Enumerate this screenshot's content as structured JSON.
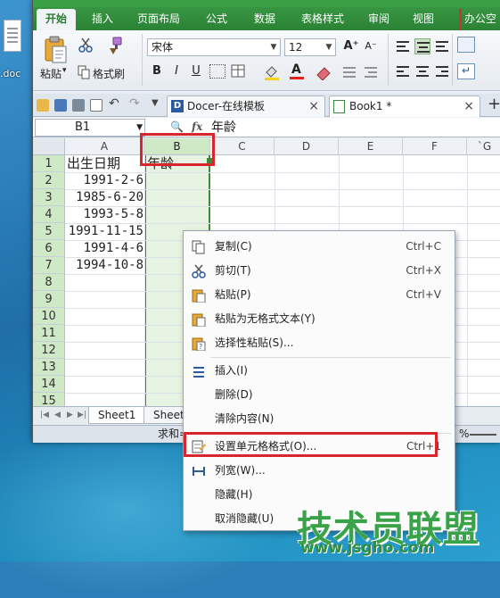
{
  "desktop": {
    "file_label": ".doc"
  },
  "ribbon_tabs": [
    "开始",
    "插入",
    "页面布局",
    "公式",
    "数据",
    "表格样式",
    "审阅",
    "视图",
    "办公空"
  ],
  "ribbon": {
    "paste": "粘贴",
    "format_painter": "格式刷",
    "font_name": "宋体",
    "font_size": "12",
    "bold": "B",
    "italic": "I",
    "underline": "U",
    "grow_font": "A⁺",
    "shrink_font": "A⁻"
  },
  "doc_tabs": [
    {
      "label": "Docer-在线模板",
      "close": "×"
    },
    {
      "label": "Book1 *",
      "close": "×"
    }
  ],
  "formula_bar": {
    "name_box": "B1",
    "fx": "fx",
    "value": "年龄"
  },
  "columns": [
    "A",
    "B",
    "C",
    "D",
    "E",
    "F",
    "`G"
  ],
  "rows": [
    "1",
    "2",
    "3",
    "4",
    "5",
    "6",
    "7",
    "8",
    "9",
    "10",
    "11",
    "12",
    "13",
    "14",
    "15"
  ],
  "cells": {
    "A1": "出生日期",
    "B1": "年龄",
    "A2": "1991-2-6",
    "A3": "1985-6-20",
    "A4": "1993-5-8",
    "A5": "1991-11-15",
    "A6": "1991-4-6",
    "A7": "1994-10-8"
  },
  "sheets": [
    "Sheet1",
    "Sheet2"
  ],
  "status": {
    "sum_label": "求和=",
    "zoom_fragment": "%"
  },
  "context_menu": [
    {
      "label": "复制(C)",
      "shortcut": "Ctrl+C",
      "icon": "copy-icon"
    },
    {
      "label": "剪切(T)",
      "shortcut": "Ctrl+X",
      "icon": "scissors-icon"
    },
    {
      "label": "粘贴(P)",
      "shortcut": "Ctrl+V",
      "icon": "paste-icon"
    },
    {
      "label": "粘贴为无格式文本(Y)",
      "shortcut": "",
      "icon": "paste-text-icon"
    },
    {
      "label": "选择性粘贴(S)...",
      "shortcut": "",
      "icon": "paste-special-icon"
    },
    {
      "label": "插入(I)",
      "shortcut": "",
      "icon": "insert-icon"
    },
    {
      "label": "删除(D)",
      "shortcut": "",
      "icon": ""
    },
    {
      "label": "清除内容(N)",
      "shortcut": "",
      "icon": ""
    },
    {
      "label": "设置单元格格式(O)...",
      "shortcut": "Ctrl+1",
      "icon": "format-cells-icon"
    },
    {
      "label": "列宽(W)...",
      "shortcut": "",
      "icon": "column-width-icon"
    },
    {
      "label": "隐藏(H)",
      "shortcut": "",
      "icon": ""
    },
    {
      "label": "取消隐藏(U)",
      "shortcut": "",
      "icon": ""
    }
  ],
  "watermark": {
    "title": "技术员联盟",
    "url": "www.jsgho.com"
  },
  "colors": {
    "accent_green": "#3aa044",
    "highlight_red": "#d9262c",
    "selection_green": "#e7f3e2"
  }
}
